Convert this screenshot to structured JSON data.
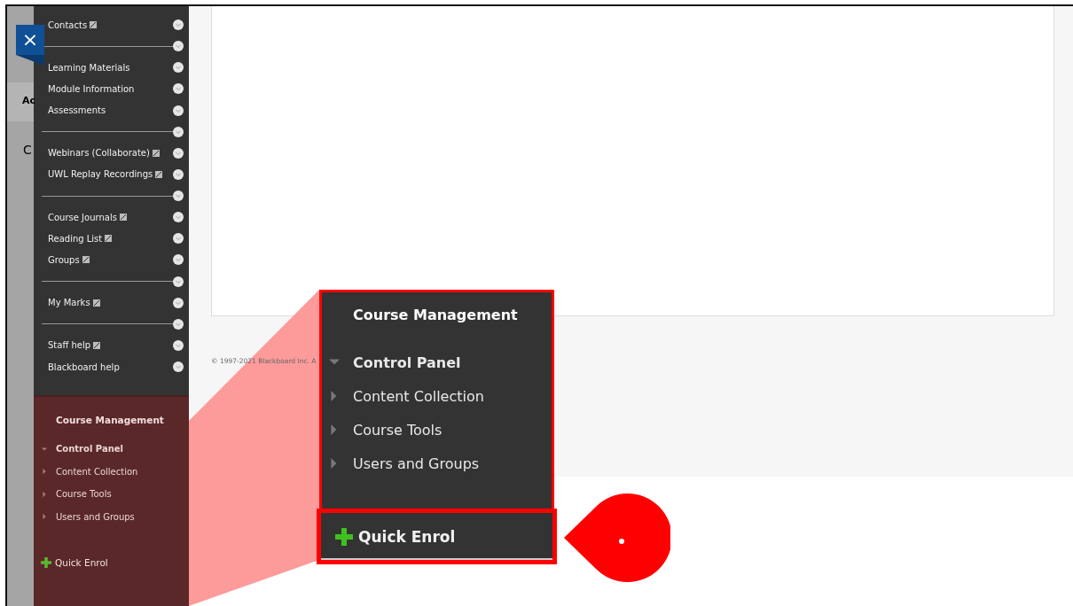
{
  "close_button": {
    "label": "×"
  },
  "background_page": {
    "fragments": [
      "Ac",
      "C"
    ]
  },
  "course_menu": {
    "items": [
      {
        "kind": "link",
        "label": "Contacts",
        "external": true
      },
      {
        "kind": "divider"
      },
      {
        "kind": "link",
        "label": "Learning Materials",
        "external": false
      },
      {
        "kind": "link",
        "label": "Module Information",
        "external": false
      },
      {
        "kind": "link",
        "label": "Assessments",
        "external": false
      },
      {
        "kind": "divider"
      },
      {
        "kind": "link",
        "label": "Webinars (Collaborate)",
        "external": true
      },
      {
        "kind": "link",
        "label": "UWL Replay Recordings",
        "external": true
      },
      {
        "kind": "divider"
      },
      {
        "kind": "link",
        "label": "Course Journals",
        "external": true
      },
      {
        "kind": "link",
        "label": "Reading List",
        "external": true
      },
      {
        "kind": "link",
        "label": "Groups",
        "external": true
      },
      {
        "kind": "divider"
      },
      {
        "kind": "link",
        "label": "My Marks",
        "external": true
      },
      {
        "kind": "divider"
      },
      {
        "kind": "link",
        "label": "Staff help",
        "external": true
      },
      {
        "kind": "link",
        "label": "Blackboard help",
        "external": false
      }
    ]
  },
  "course_management": {
    "title": "Course Management",
    "items": [
      {
        "label": "Control Panel",
        "expanded": true
      },
      {
        "label": "Content Collection",
        "expanded": false
      },
      {
        "label": "Course Tools",
        "expanded": false
      },
      {
        "label": "Users and Groups",
        "expanded": false
      }
    ],
    "quick_enrol": "Quick Enrol"
  },
  "footer": {
    "copyright": "© 1997-2021 Blackboard Inc. A"
  },
  "callout": {
    "title": "Course Management",
    "items": [
      {
        "label": "Control Panel",
        "expanded": true
      },
      {
        "label": "Content Collection",
        "expanded": false
      },
      {
        "label": "Course Tools",
        "expanded": false
      },
      {
        "label": "Users and Groups",
        "expanded": false
      }
    ],
    "quick_enrol": "Quick Enrol"
  }
}
